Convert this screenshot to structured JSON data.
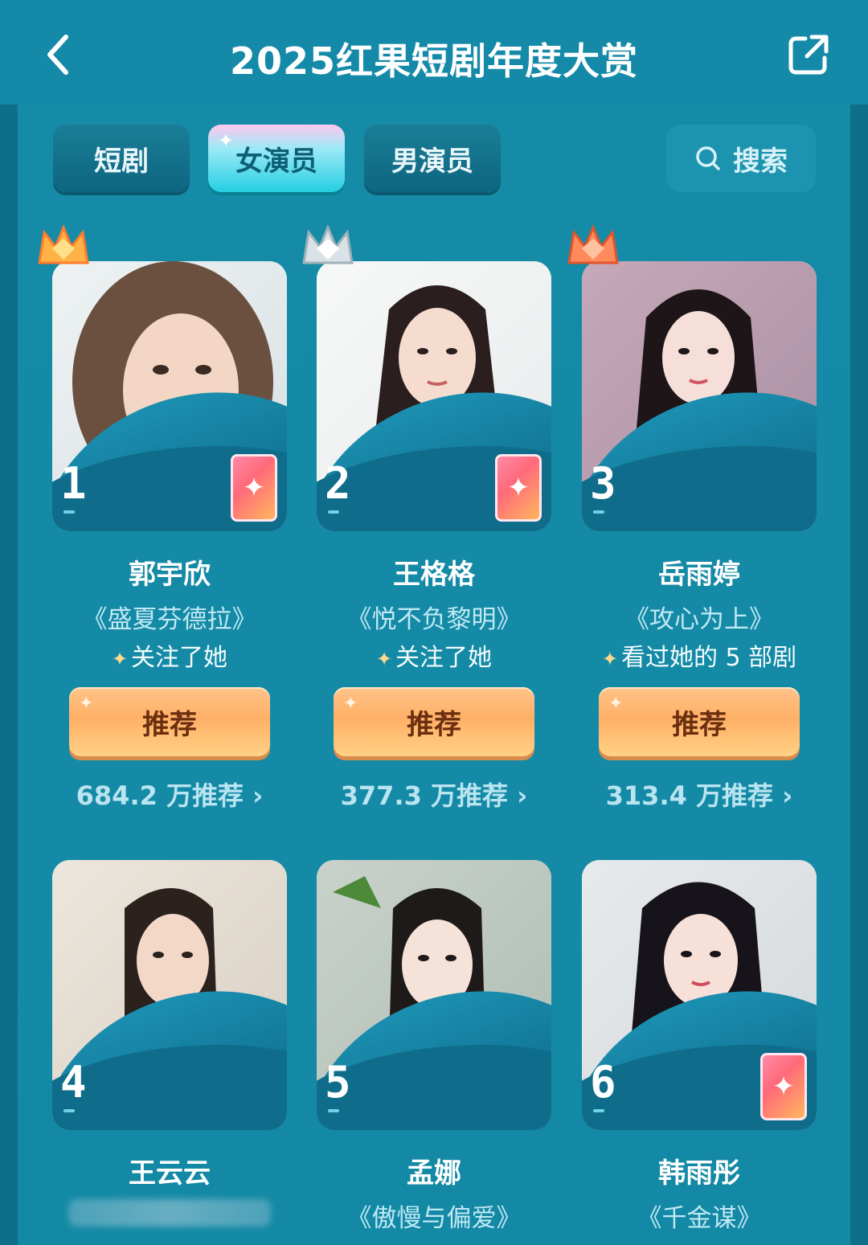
{
  "header": {
    "title": "2025红果短剧年度大赏"
  },
  "tabs": [
    {
      "label": "短剧",
      "active": false
    },
    {
      "label": "女演员",
      "active": true
    },
    {
      "label": "男演员",
      "active": false
    }
  ],
  "search": {
    "label": "搜索",
    "icon": "search-icon"
  },
  "actresses": [
    {
      "rank": "1",
      "name": "郭宇欣",
      "drama": "《盛夏芬德拉》",
      "note": "关注了她",
      "button": "推荐",
      "count": "684.2 万推荐 ›",
      "crown": "gold"
    },
    {
      "rank": "2",
      "name": "王格格",
      "drama": "《悦不负黎明》",
      "note": "关注了她",
      "button": "推荐",
      "count": "377.3 万推荐 ›",
      "crown": "silver"
    },
    {
      "rank": "3",
      "name": "岳雨婷",
      "drama": "《攻心为上》",
      "note": "看过她的 5 部剧",
      "button": "推荐",
      "count": "313.4 万推荐 ›",
      "crown": "bronze"
    },
    {
      "rank": "4",
      "name": "王云云",
      "drama": "",
      "note": "",
      "button": "",
      "count": ""
    },
    {
      "rank": "5",
      "name": "孟娜",
      "drama": "《傲慢与偏爱》",
      "note": "",
      "button": "",
      "count": ""
    },
    {
      "rank": "6",
      "name": "韩雨彤",
      "drama": "《千金谋》",
      "note": "",
      "button": "",
      "count": ""
    }
  ],
  "colors": {
    "accent": "#158aa8",
    "button": "#ffb067",
    "crown_gold": "#ffb347",
    "crown_silver": "#d9e2e6",
    "crown_bronze": "#ff8a5c"
  }
}
